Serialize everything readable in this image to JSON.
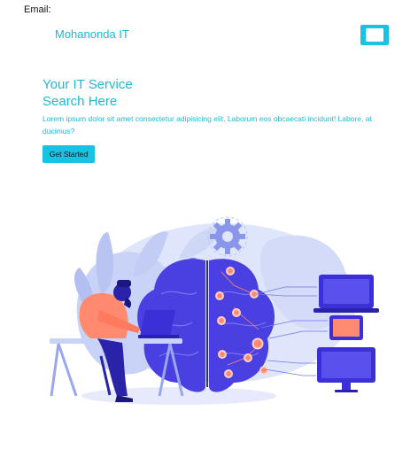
{
  "header": {
    "email_label": "Email:",
    "brand": "Mohanonda IT"
  },
  "hero": {
    "title_line1": "Your IT Service",
    "title_line2": "Search Here",
    "description": "Lorem ipsum dolor sit amet consectetur adipisicing elit. Laborum eos obcaecati incidunt! Labore, at ducimus?",
    "cta_label": "Get Started"
  },
  "colors": {
    "accent": "#17c2e3",
    "brand_text": "#1fb8d4",
    "illustration_primary": "#4a3fe0",
    "illustration_soft": "#c9d3f7",
    "node_orange": "#ff8a70"
  },
  "icons": {
    "menu": "menu-toggle-icon"
  }
}
